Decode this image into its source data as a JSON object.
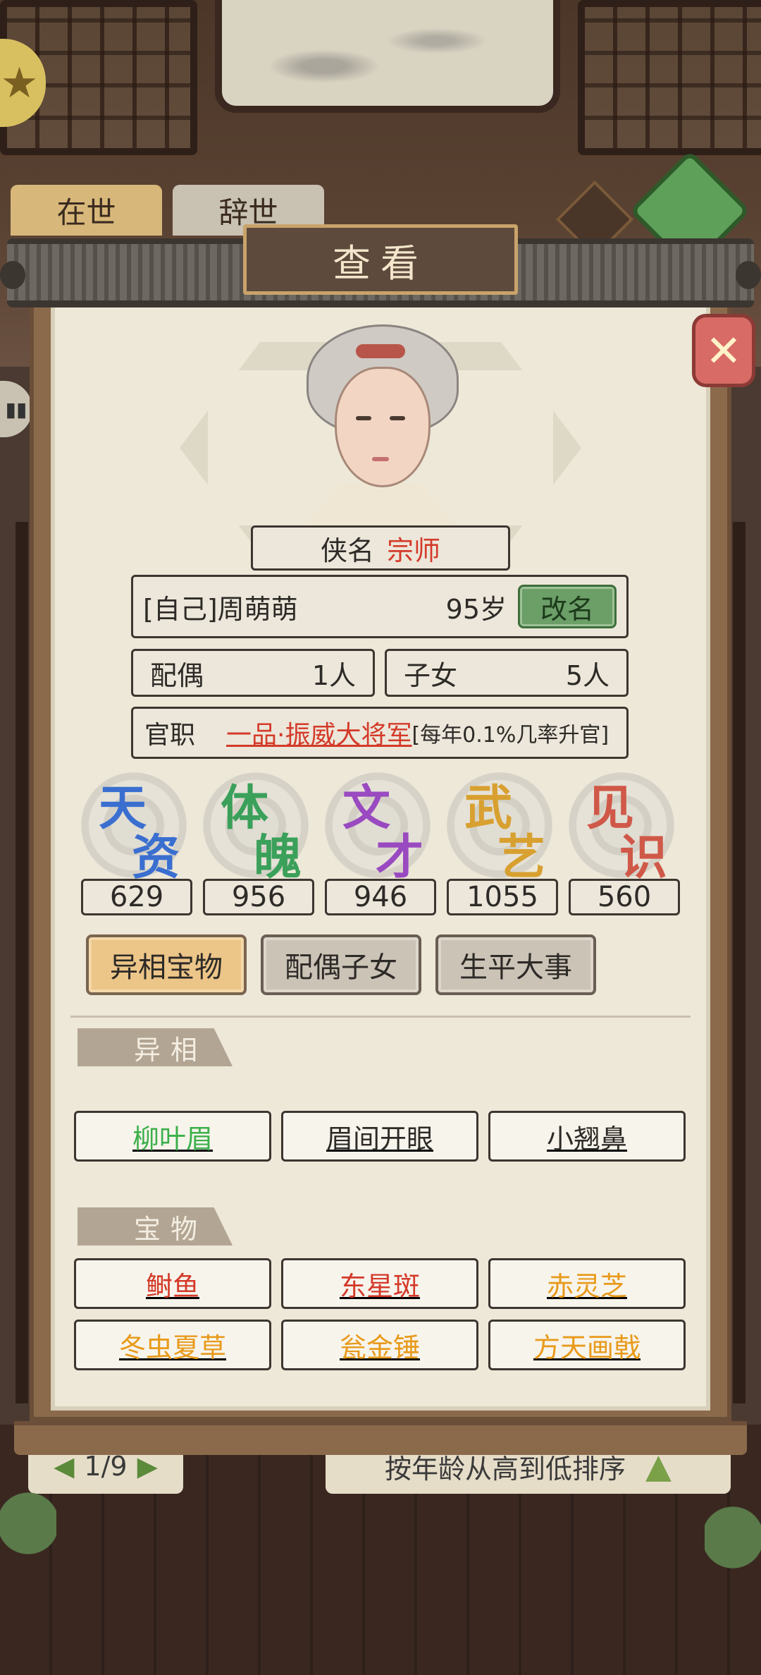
{
  "background": {
    "tab_left": "在世",
    "tab_right": "辞世",
    "page_indicator": "1/9",
    "sort_label": "按年龄从高到低排序"
  },
  "dialog": {
    "title": "查看",
    "close_icon": "close-x-icon"
  },
  "profile": {
    "alias_label": "侠名",
    "alias_value": "宗师",
    "name": "[自己]周萌萌",
    "age": "95岁",
    "rename_label": "改名",
    "spouse_label": "配偶",
    "spouse_value": "1人",
    "children_label": "子女",
    "children_value": "5人",
    "official_label": "官职",
    "official_title": "一品·振威大将军",
    "official_note": "[每年0.1%几率升官]"
  },
  "stats": [
    {
      "c1": "天",
      "c2": "资",
      "value": "629",
      "color": "#3a6fd0"
    },
    {
      "c1": "体",
      "c2": "魄",
      "value": "956",
      "color": "#3aa05a"
    },
    {
      "c1": "文",
      "c2": "才",
      "value": "946",
      "color": "#9a4ac0"
    },
    {
      "c1": "武",
      "c2": "艺",
      "value": "1055",
      "color": "#d8a030"
    },
    {
      "c1": "见",
      "c2": "识",
      "value": "560",
      "color": "#d05848"
    }
  ],
  "tabs": [
    {
      "label": "异相宝物",
      "active": true
    },
    {
      "label": "配偶子女",
      "active": false
    },
    {
      "label": "生平大事",
      "active": false
    }
  ],
  "traits": {
    "header": "异相",
    "items": [
      {
        "label": "柳叶眉",
        "color": "#3cb04a"
      },
      {
        "label": "眉间开眼",
        "color": "#2d2a27"
      },
      {
        "label": "小翘鼻",
        "color": "#2d2a27"
      }
    ]
  },
  "treasures": {
    "header": "宝物",
    "items": [
      {
        "label": "鲥鱼",
        "color": "#d43a2a"
      },
      {
        "label": "东星斑",
        "color": "#d43a2a"
      },
      {
        "label": "赤灵芝",
        "color": "#e89a1a"
      },
      {
        "label": "冬虫夏草",
        "color": "#e89a1a"
      },
      {
        "label": "瓮金锤",
        "color": "#e89a1a"
      },
      {
        "label": "方天画戟",
        "color": "#e89a1a"
      }
    ]
  }
}
